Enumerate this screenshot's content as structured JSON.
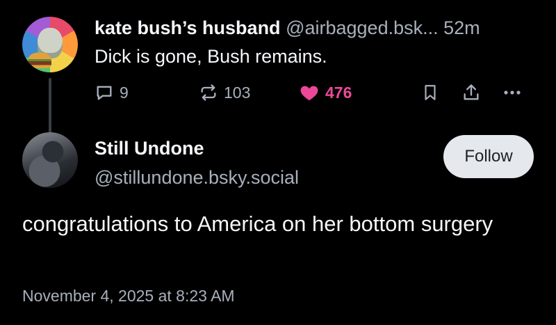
{
  "parent_post": {
    "author_name": "kate bush’s husband",
    "author_handle": "@airbagged.bsk...",
    "time_ago": "52m",
    "text": "Dick is gone, Bush remains.",
    "actions": {
      "reply_count": "9",
      "repost_count": "103",
      "like_count": "476"
    }
  },
  "main_post": {
    "author_name": "Still Undone",
    "author_handle": "@stillundone.bsky.social",
    "follow_label": "Follow",
    "text": "congratulations to America on her bottom surgery",
    "timestamp": "November 4, 2025 at 8:23 AM"
  },
  "colors": {
    "background": "#000000",
    "text": "#f5f7fa",
    "muted": "#a8b0bc",
    "like": "#ec4899",
    "follow_bg": "#e5e8ec"
  },
  "icons": [
    "reply-icon",
    "repost-icon",
    "heart-icon",
    "bookmark-icon",
    "share-icon",
    "more-icon"
  ]
}
